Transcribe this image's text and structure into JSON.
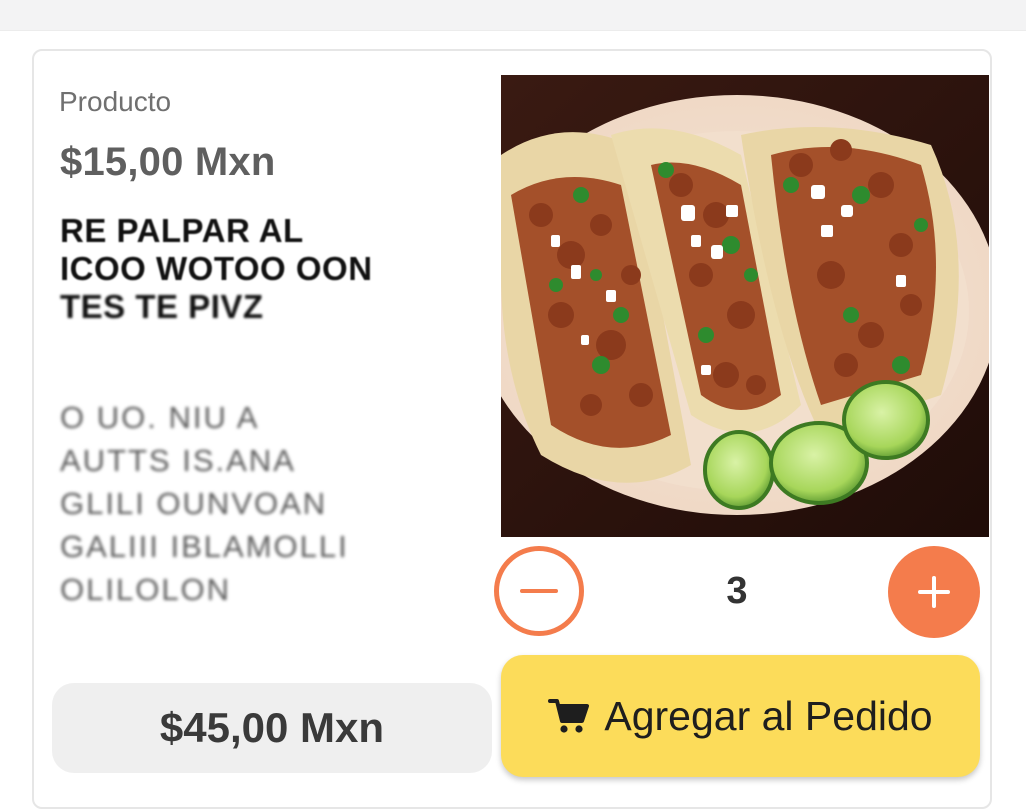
{
  "product": {
    "section_label": "Producto",
    "unit_price": "$15,00 Mxn",
    "name_lines": [
      "RE PALPAR AL",
      "ICOO WOTOO OON",
      "TES TE PIVZ"
    ],
    "description_lines": [
      "O UO. NIU A",
      "AUTTS IS.ANA",
      "GLILI OUNVOAN",
      "GALIII IBLAMOLLI",
      "OLILOLON"
    ],
    "image_alt": "Tacos al pastor con cebolla, cilantro y limón"
  },
  "quantity": {
    "value": "3",
    "minus_icon": "minus-icon",
    "plus_icon": "plus-icon"
  },
  "total": {
    "amount": "$45,00 Mxn"
  },
  "add_button": {
    "label": "Agregar al Pedido",
    "icon": "cart-icon"
  },
  "colors": {
    "accent": "#f47c4c",
    "button_yellow": "#fcdc5a",
    "total_bg": "#efefef"
  }
}
